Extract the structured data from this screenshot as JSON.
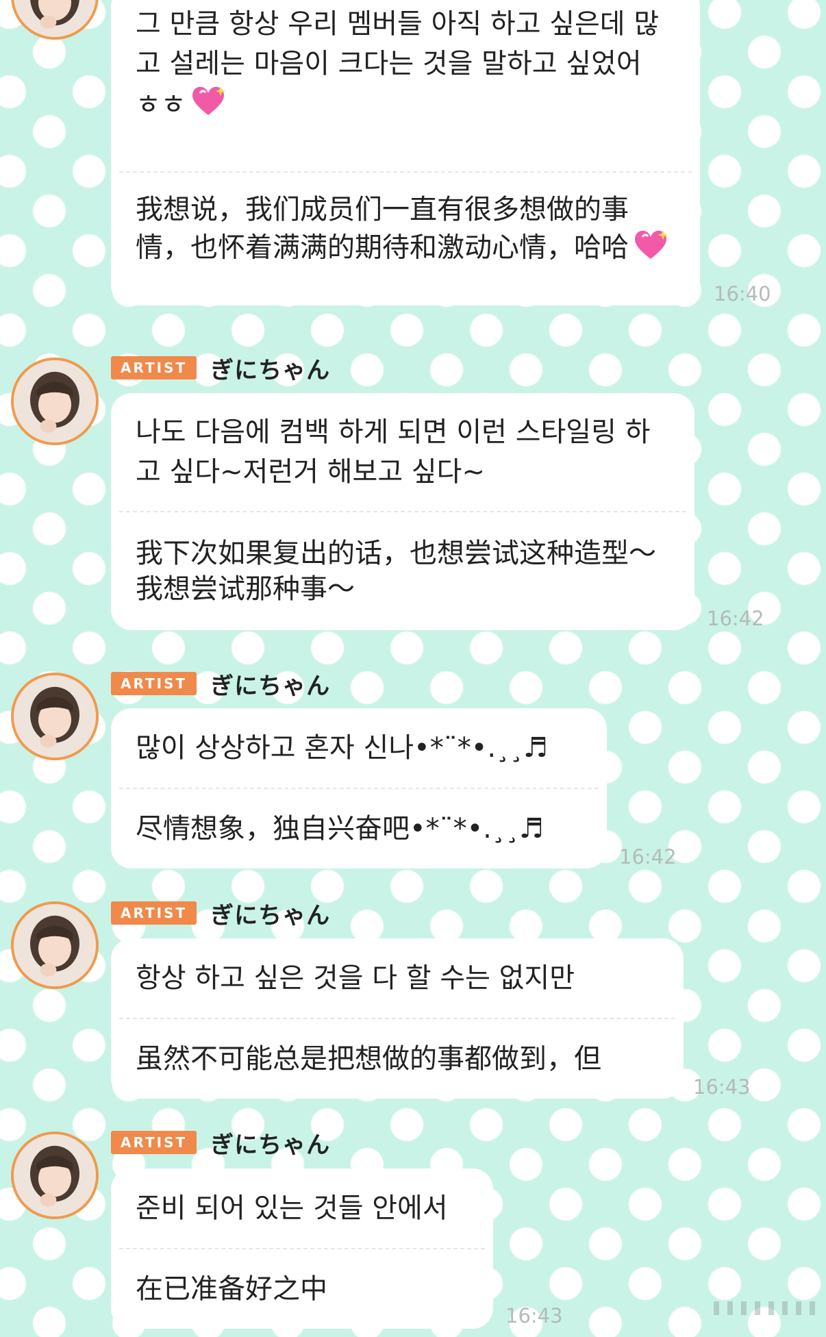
{
  "colors": {
    "background": "#c9f3e6",
    "bubble": "#ffffff",
    "badge": "#f0894a",
    "avatar_ring": "#f19a4d",
    "timestamp": "#b4bbb8"
  },
  "messages": [
    {
      "text_ko": "그 만큼 항상 우리 멤버들 아직 하고 싶은데 많고 설레는 마음이 크다는 것을 말하고 싶었어 ㅎㅎ",
      "text_zh": "我想说，我们成员们一直有很多想做的事情，也怀着满满的期待和激动心情，哈哈",
      "emoji": "sparkling-heart-icon",
      "time": "16:40"
    },
    {
      "badge": "ARTIST",
      "sender": "ぎにちゃん",
      "text_ko": "나도 다음에 컴백 하게 되면 이런 스타일링 하고 싶다~저런거 해보고 싶다~",
      "text_zh": "我下次如果复出的话，也想尝试这种造型～我想尝试那种事～",
      "time": "16:42"
    },
    {
      "badge": "ARTIST",
      "sender": "ぎにちゃん",
      "text_ko": "많이 상상하고 혼자 신나•*¨*•.¸¸♬",
      "text_zh": "尽情想象，独自兴奋吧•*¨*•.¸¸♬",
      "time": "16:42"
    },
    {
      "badge": "ARTIST",
      "sender": "ぎにちゃん",
      "text_ko": "항상 하고 싶은 것을 다 할 수는 없지만",
      "text_zh": "虽然不可能总是把想做的事都做到，但",
      "time": "16:43"
    },
    {
      "badge": "ARTIST",
      "sender": "ぎにちゃん",
      "text_ko": "준비 되어 있는 것들 안에서",
      "text_zh": "在已准备好之中",
      "time": "16:43"
    }
  ]
}
